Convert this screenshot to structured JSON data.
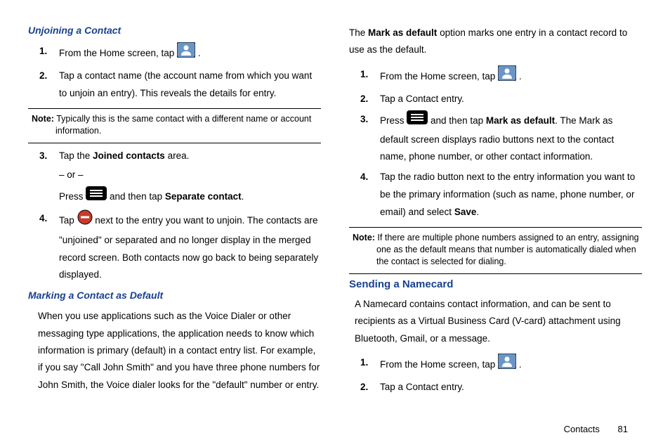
{
  "left": {
    "h1": "Unjoining a Contact",
    "li1a": "From the Home screen, tap ",
    "li1b": " .",
    "li2": "Tap a contact name (the account name from which you want to unjoin an entry). This reveals the details for entry.",
    "noteLabel": "Note:",
    "noteText": " Typically this is the same contact with a different name or account information.",
    "li3a": "Tap the ",
    "li3bold": "Joined contacts",
    "li3b": " area.",
    "or": "– or –",
    "li3c": "Press ",
    "li3d": " and then tap ",
    "li3bold2": "Separate contact",
    "li3e": ".",
    "li4a": "Tap ",
    "li4b": " next to the entry you want to unjoin. The contacts are \"unjoined\" or separated and no longer display in the merged record screen. Both contacts now go back to being separately displayed.",
    "h2": "Marking a Contact as Default",
    "p1": "When you use applications such as the Voice Dialer or other messaging type applications, the application needs to know which information is primary (default) in a contact entry list. For example, if you say \"Call John Smith\" and you have three phone numbers for John Smith, the Voice dialer looks for the \"default\" number or entry."
  },
  "right": {
    "p1a": "The ",
    "p1bold": "Mark as default",
    "p1b": " option marks one entry in a contact record to use as the default.",
    "li1a": "From the Home screen, tap ",
    "li1b": " .",
    "li2": "Tap a Contact entry.",
    "li3a": "Press ",
    "li3b": " and then tap ",
    "li3bold": "Mark as default",
    "li3c": ". The Mark as default screen displays radio buttons next to the contact name, phone number, or other contact information.",
    "li4a": "Tap the radio button next to the entry information you want to be the primary information (such as name, phone number, or email) and select ",
    "li4bold": "Save",
    "li4b": ".",
    "noteLabel": "Note:",
    "noteText": " If there are multiple phone numbers assigned to an entry, assigning one as the default means that number is automatically dialed when the contact is selected for dialing.",
    "h1": "Sending a Namecard",
    "p2": "A Namecard contains contact information, and can be sent to recipients as a Virtual Business Card (V-card) attachment using Bluetooth, Gmail, or a message.",
    "li5a": "From the Home screen, tap ",
    "li5b": " .",
    "li6": "Tap a Contact entry."
  },
  "footer": {
    "section": "Contacts",
    "page": "81"
  }
}
